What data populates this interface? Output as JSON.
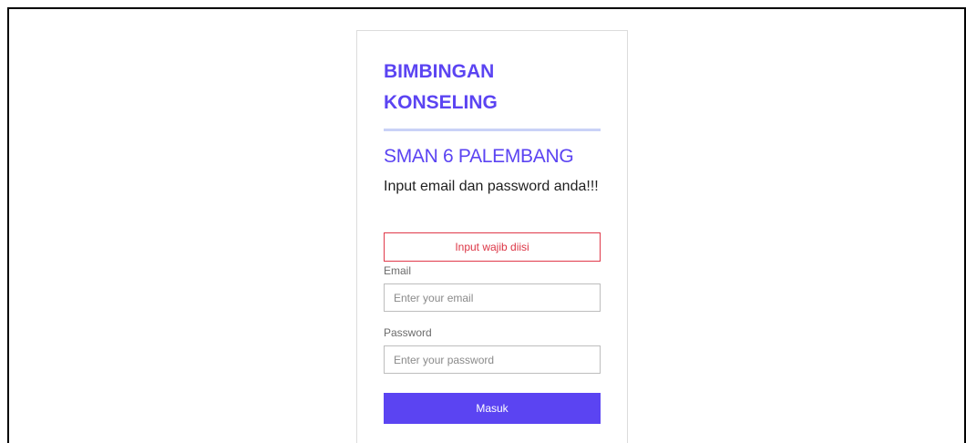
{
  "login": {
    "app_title": "BIMBINGAN KONSELING",
    "school_name": "SMAN 6 PALEMBANG",
    "instruction": "Input email dan password anda!!!",
    "alert_message": "Input wajib diisi",
    "email_label": "Email",
    "email_placeholder": "Enter your email",
    "email_value": "",
    "password_label": "Password",
    "password_placeholder": "Enter your password",
    "password_value": "",
    "submit_label": "Masuk"
  },
  "colors": {
    "accent": "#5b44f2",
    "error": "#dc3545",
    "divider": "#c9d2f7",
    "text": "#1f1f1f"
  }
}
